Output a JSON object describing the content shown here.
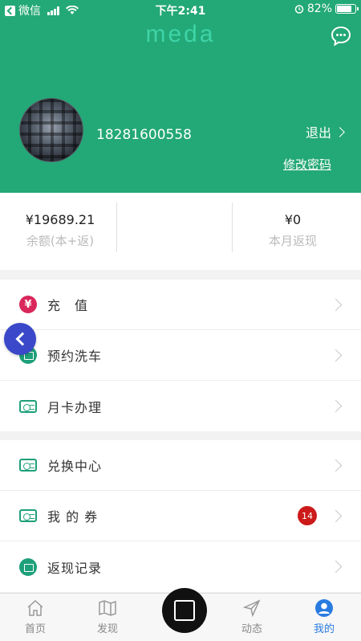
{
  "status_bar": {
    "carrier": "微信",
    "time": "下午2:41",
    "battery": "82%"
  },
  "header": {
    "logo": "meda",
    "phone": "18281600558",
    "logout_label": "退出",
    "change_password_label": "修改密码"
  },
  "stats": [
    {
      "value": "¥19689.21",
      "label": "余额(本+返)"
    },
    {
      "value": "¥0",
      "label": "本月返现"
    }
  ],
  "menu_group_1": [
    {
      "label": "充　值",
      "icon": "yen-icon"
    },
    {
      "label": "预约洗车",
      "icon": "car-wash-icon"
    },
    {
      "label": "月卡办理",
      "icon": "card-icon"
    }
  ],
  "menu_group_2": [
    {
      "label": "兑换中心",
      "icon": "card-icon"
    },
    {
      "label": "我 的 券",
      "icon": "card-icon",
      "badge": "14"
    },
    {
      "label": "返现记录",
      "icon": "record-icon"
    }
  ],
  "tabs": [
    {
      "label": "首页",
      "icon": "home-icon"
    },
    {
      "label": "发现",
      "icon": "map-icon"
    },
    {
      "label": "动态",
      "icon": "send-icon"
    },
    {
      "label": "我的",
      "icon": "user-icon",
      "active": true
    }
  ],
  "colors": {
    "primary": "#23a877",
    "active_tab": "#2a7be0",
    "badge": "#cc1a1a"
  }
}
